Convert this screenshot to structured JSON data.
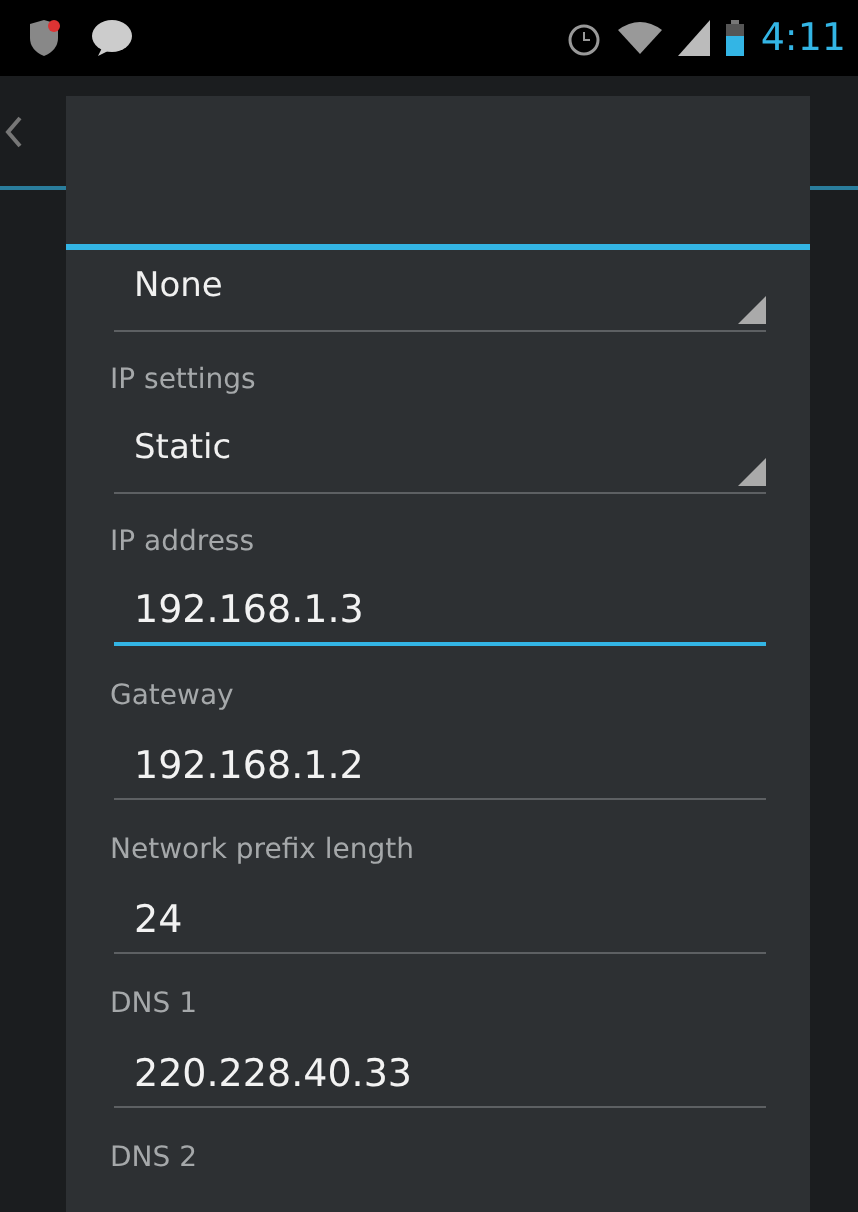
{
  "status_bar": {
    "time": "4:11"
  },
  "dialog": {
    "items": [
      {
        "kind": "spinner",
        "value": "None"
      },
      {
        "kind": "label",
        "text": "IP settings"
      },
      {
        "kind": "spinner",
        "value": "Static"
      },
      {
        "kind": "label",
        "text": "IP address"
      },
      {
        "kind": "input",
        "value": "192.168.1.3",
        "focused": true
      },
      {
        "kind": "label",
        "text": "Gateway"
      },
      {
        "kind": "input",
        "value": "192.168.1.2",
        "focused": false
      },
      {
        "kind": "label",
        "text": "Network prefix length"
      },
      {
        "kind": "input",
        "value": "24",
        "focused": false
      },
      {
        "kind": "label",
        "text": "DNS 1"
      },
      {
        "kind": "input",
        "value": "220.228.40.33",
        "focused": false
      },
      {
        "kind": "label",
        "text": "DNS 2"
      }
    ]
  }
}
